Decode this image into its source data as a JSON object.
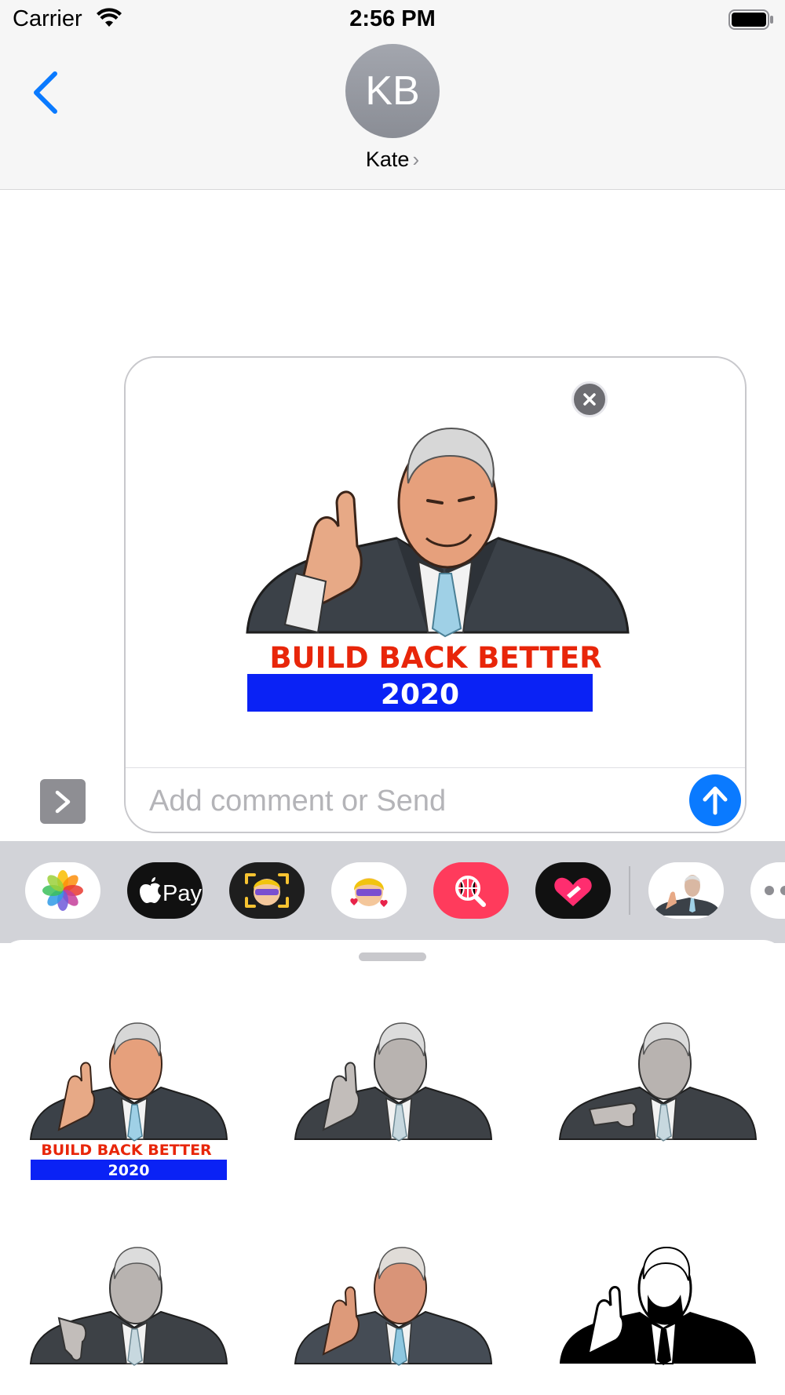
{
  "status_bar": {
    "carrier": "Carrier",
    "time": "2:56 PM"
  },
  "header": {
    "avatar_initials": "KB",
    "contact_name": "Kate"
  },
  "compose": {
    "sticker_text_top": "BUILD BACK BETTER",
    "sticker_text_bottom": "2020",
    "comment_placeholder": "Add comment or Send",
    "comment_value": ""
  },
  "app_drawer": {
    "apps": [
      {
        "name": "photos-icon"
      },
      {
        "name": "apple-pay-icon",
        "label": "Pay"
      },
      {
        "name": "memoji-icon"
      },
      {
        "name": "memoji-stickers-icon"
      },
      {
        "name": "images-search-icon"
      },
      {
        "name": "digital-touch-icon"
      },
      {
        "name": "sticker-app-icon"
      },
      {
        "name": "more-apps-icon"
      }
    ]
  },
  "sticker_grid": {
    "stickers": [
      {
        "style": "color-thumbs-up",
        "caption_top": "BUILD BACK BETTER",
        "caption_bottom": "2020"
      },
      {
        "style": "gray-thumbs-up"
      },
      {
        "style": "gray-thumbs-down"
      },
      {
        "style": "gray-thumbs-down-2"
      },
      {
        "style": "color-textured-thumbs-up"
      },
      {
        "style": "black-white-thumbs-up"
      }
    ]
  },
  "colors": {
    "accent_blue": "#0a7aff",
    "caption_red": "#e8260a",
    "caption_bar_blue": "#0a22f5",
    "drawer_bg": "#d2d3d8"
  }
}
